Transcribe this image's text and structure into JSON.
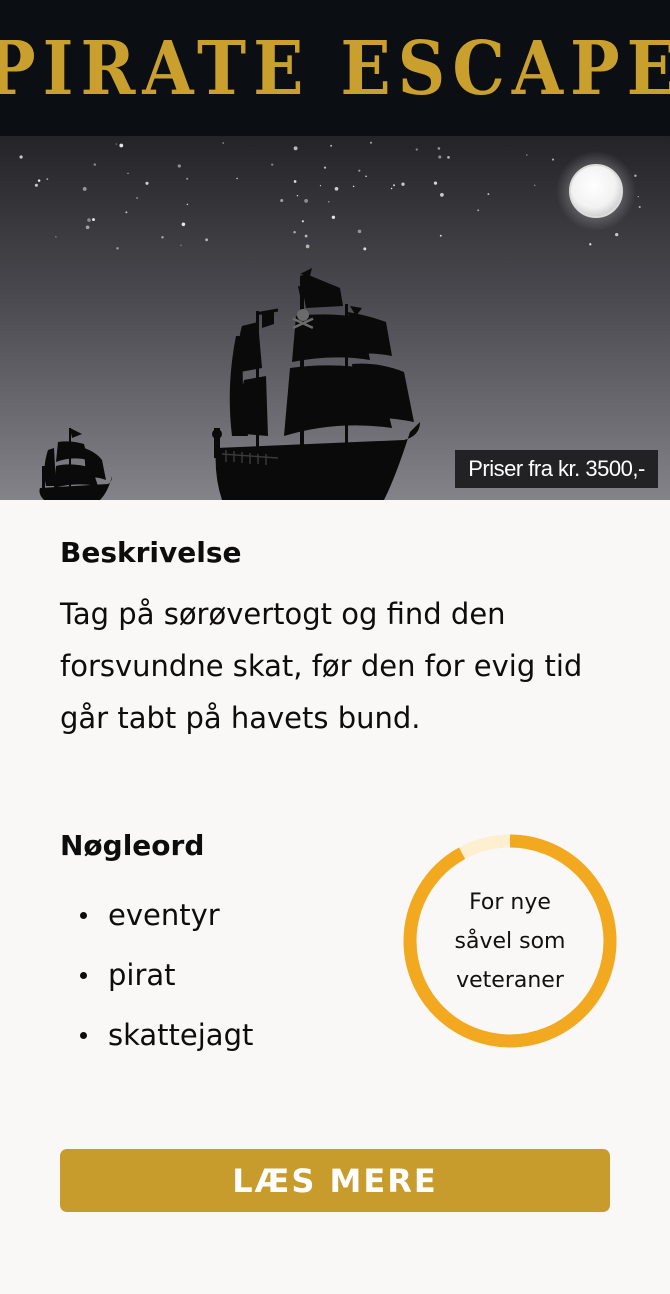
{
  "header": {
    "title": "Pirate Escape"
  },
  "hero": {
    "price_label": "Priser fra kr. 3500,-",
    "colors": {
      "sky_top": "#242428",
      "sky_bottom": "#838389",
      "moon": "#ffffff"
    }
  },
  "description": {
    "heading": "Beskrivelse",
    "text": "Tag på sørøvertogt og find den forsvundne skat, før den for evig tid går tabt på havets bund."
  },
  "keywords": {
    "heading": "Nøgleord",
    "items": [
      "eventyr",
      "pirat",
      "skattejagt"
    ]
  },
  "audience_ring": {
    "label": "For nye såvel som veteraner",
    "fill_fraction": 0.92,
    "colors": {
      "fill": "#f2a91f",
      "track": "#fdefd0"
    }
  },
  "cta": {
    "label": "LÆS MERE",
    "color": "#c79c2c"
  }
}
